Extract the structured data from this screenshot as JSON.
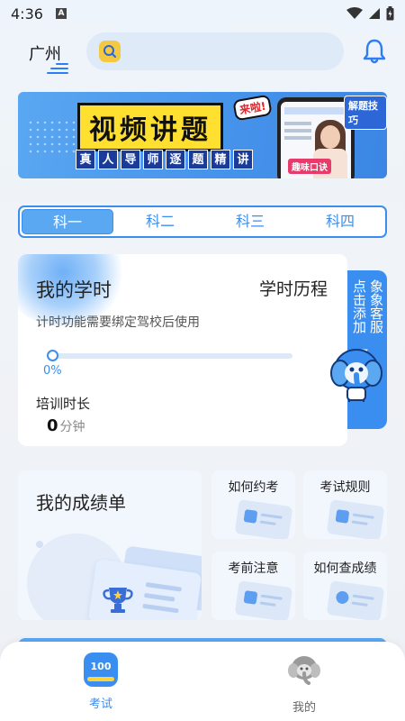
{
  "status_bar": {
    "time": "4:36"
  },
  "header": {
    "city": "广州"
  },
  "banner": {
    "title": "视频讲题",
    "tag": "来啦!",
    "subtitle_chars": [
      "真",
      "人",
      "导",
      "师",
      "逐",
      "题",
      "精",
      "讲"
    ],
    "skill": "解题技巧",
    "formula": "趣味口诀"
  },
  "subject_tabs": [
    "科一",
    "科二",
    "科三",
    "科四"
  ],
  "active_tab_index": 0,
  "study_card": {
    "title": "我的学时",
    "history_link": "学时历程",
    "note": "计时功能需要绑定驾校后使用",
    "progress_label": "0%",
    "progress": 0,
    "duration_label": "培训时长",
    "duration_value": "0",
    "duration_unit": "分钟"
  },
  "service": {
    "line1": "点击添加",
    "line2": "象象客服"
  },
  "grade_card": {
    "title": "我的成绩单"
  },
  "quick_links": [
    "如何约考",
    "考试规则",
    "考前注意",
    "如何查成绩"
  ],
  "bottom_nav": {
    "exam": {
      "label": "考试",
      "badge": "100"
    },
    "mine": {
      "label": "我的"
    }
  }
}
